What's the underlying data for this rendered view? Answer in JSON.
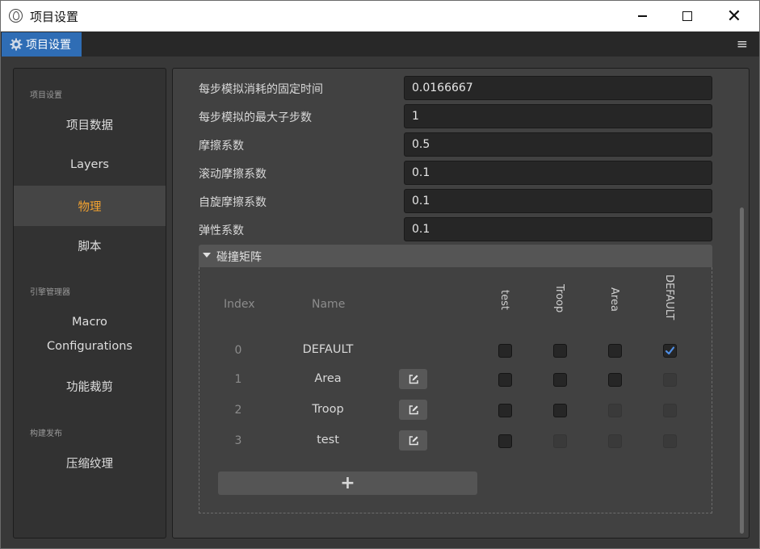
{
  "window": {
    "title": "项目设置",
    "icons": {
      "app": "cocos-logo-icon",
      "minimize": "minimize-icon",
      "maximize": "maximize-icon",
      "close": "close-icon"
    },
    "close_glyph": "✕"
  },
  "tabs": {
    "active_label": "项目设置",
    "tab_icon": "gear-icon",
    "menu_glyph": "≡"
  },
  "sidebar": {
    "groups": [
      {
        "label": "项目设置",
        "items": [
          {
            "label": "项目数据"
          },
          {
            "label": "Layers"
          },
          {
            "label": "物理",
            "active": true
          },
          {
            "label": "脚本"
          }
        ]
      },
      {
        "label": "引擎管理器",
        "items": [
          {
            "label": "Macro"
          },
          {
            "label": "Configurations"
          },
          {
            "label": "功能裁剪"
          }
        ]
      },
      {
        "label": "构建发布",
        "items": [
          {
            "label": "压缩纹理"
          }
        ]
      }
    ],
    "active_color": "#f2a230"
  },
  "physics": {
    "properties": [
      {
        "label": "每步模拟消耗的固定时间",
        "value": "0.0166667"
      },
      {
        "label": "每步模拟的最大子步数",
        "value": "1"
      },
      {
        "label": "摩擦系数",
        "value": "0.5"
      },
      {
        "label": "滚动摩擦系数",
        "value": "0.1"
      },
      {
        "label": "自旋摩擦系数",
        "value": "0.1"
      },
      {
        "label": "弹性系数",
        "value": "0.1"
      }
    ],
    "matrix": {
      "title": "碰撞矩阵",
      "header_index": "Index",
      "header_name": "Name",
      "columns": [
        "test",
        "Troop",
        "Area",
        "DEFAULT"
      ],
      "rows": [
        {
          "index": "0",
          "name": "DEFAULT",
          "editable": false,
          "cells": [
            "off",
            "off",
            "off",
            "on"
          ]
        },
        {
          "index": "1",
          "name": "Area",
          "editable": true,
          "cells": [
            "off",
            "off",
            "off",
            "disabled"
          ]
        },
        {
          "index": "2",
          "name": "Troop",
          "editable": true,
          "cells": [
            "off",
            "off",
            "disabled",
            "disabled"
          ]
        },
        {
          "index": "3",
          "name": "test",
          "editable": true,
          "cells": [
            "off",
            "disabled",
            "disabled",
            "disabled"
          ]
        }
      ],
      "add_label": "+",
      "check_color": "#4f8fe6"
    }
  }
}
